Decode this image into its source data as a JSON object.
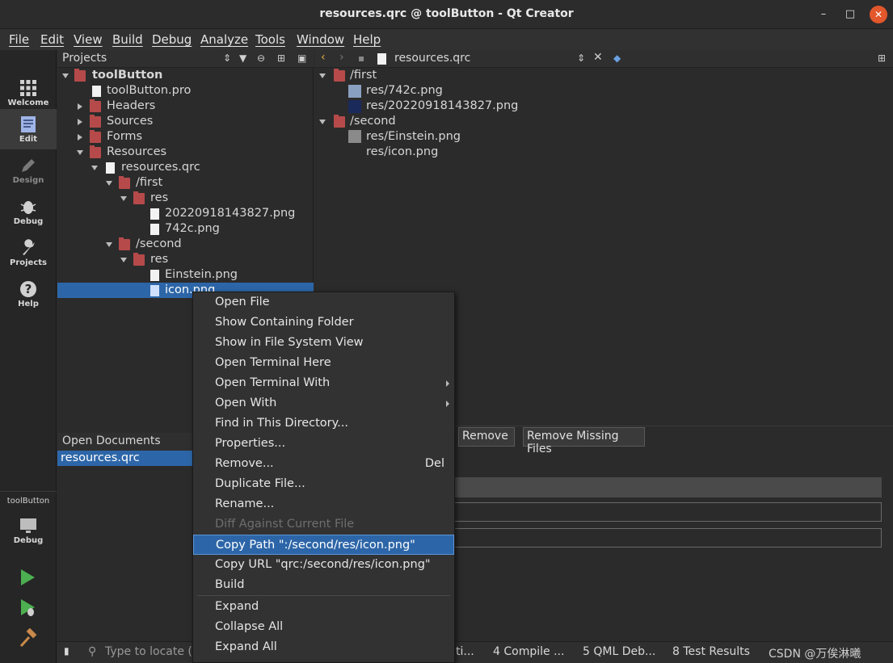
{
  "window": {
    "title": "resources.qrc @ toolButton - Qt Creator",
    "min": "–",
    "max": "□",
    "close": "✕"
  },
  "menubar": [
    "File",
    "Edit",
    "View",
    "Build",
    "Debug",
    "Analyze",
    "Tools",
    "Window",
    "Help"
  ],
  "modes": [
    {
      "label": "Welcome",
      "icon": "grid-icon"
    },
    {
      "label": "Edit",
      "icon": "edit-doc-icon"
    },
    {
      "label": "Design",
      "icon": "pencil-icon"
    },
    {
      "label": "Debug",
      "icon": "bug-icon"
    },
    {
      "label": "Projects",
      "icon": "wrench-icon"
    },
    {
      "label": "Help",
      "icon": "help-icon"
    }
  ],
  "kit": {
    "project": "toolButton",
    "label": "Debug"
  },
  "projects_pane": {
    "title": "Projects",
    "tree": [
      {
        "label": "toolButton"
      },
      {
        "label": "toolButton.pro"
      },
      {
        "label": "Headers"
      },
      {
        "label": "Sources"
      },
      {
        "label": "Forms"
      },
      {
        "label": "Resources"
      },
      {
        "label": "resources.qrc"
      },
      {
        "label": "/first"
      },
      {
        "label": "res"
      },
      {
        "label": "20220918143827.png"
      },
      {
        "label": "742c.png"
      },
      {
        "label": "/second"
      },
      {
        "label": "res"
      },
      {
        "label": "Einstein.png"
      },
      {
        "label": "icon.png"
      }
    ]
  },
  "open_documents": {
    "title": "Open Documents",
    "items": [
      "resources.qrc"
    ]
  },
  "editor": {
    "filename": "resources.qrc",
    "tree": [
      {
        "label": "/first"
      },
      {
        "label": "res/742c.png"
      },
      {
        "label": "res/20220918143827.png"
      },
      {
        "label": "/second"
      },
      {
        "label": "res/Einstein.png"
      },
      {
        "label": "res/icon.png"
      }
    ],
    "buttons": {
      "remove": "Remove",
      "remove_missing": "Remove Missing Files"
    }
  },
  "context_menu": {
    "items": [
      {
        "label": "Open File"
      },
      {
        "label": "Show Containing Folder"
      },
      {
        "label": "Show in File System View"
      },
      {
        "label": "Open Terminal Here"
      },
      {
        "label": "Open Terminal With",
        "submenu": true
      },
      {
        "label": "Open With",
        "submenu": true
      },
      {
        "label": "Find in This Directory..."
      },
      {
        "label": "Properties..."
      },
      {
        "label": "Remove...",
        "shortcut": "Del"
      },
      {
        "label": "Duplicate File..."
      },
      {
        "label": "Rename..."
      },
      {
        "label": "Diff Against Current File",
        "disabled": true
      },
      {
        "label": "Copy Path \":/second/res/icon.png\"",
        "highlighted": true
      },
      {
        "label": "Copy URL \"qrc:/second/res/icon.png\""
      },
      {
        "label": "Build"
      },
      {
        "label": "Expand"
      },
      {
        "label": "Collapse All"
      },
      {
        "label": "Expand All"
      }
    ]
  },
  "statusbar": {
    "locator_placeholder": "Type to locate (C",
    "tabs": [
      "ti...",
      "4  Compile ...",
      "5  QML Deb...",
      "8  Test Results"
    ],
    "watermark": "CSDN @万俟淋曦"
  },
  "colors": {
    "selection": "#2d66a8",
    "close_button": "#e2572b",
    "run_green": "#4caf50"
  }
}
